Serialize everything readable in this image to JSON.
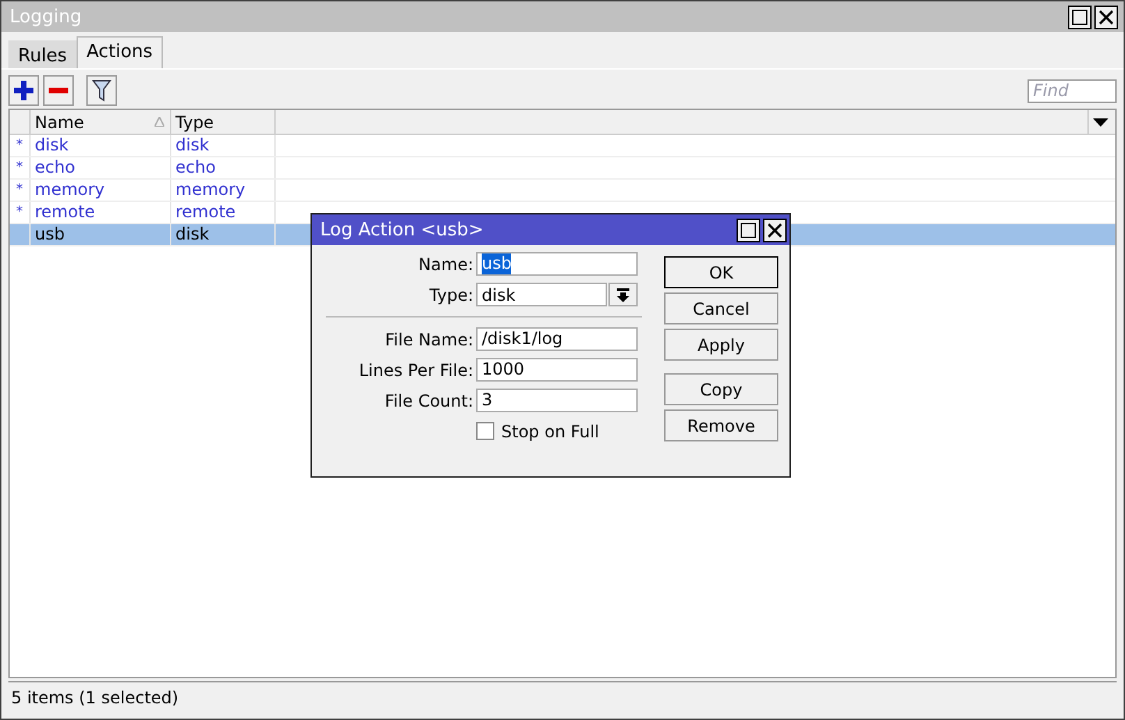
{
  "window": {
    "title": "Logging"
  },
  "tabs": [
    {
      "label": "Rules",
      "selected": false
    },
    {
      "label": "Actions",
      "selected": true
    }
  ],
  "search": {
    "placeholder": "Find"
  },
  "table": {
    "columns": [
      "Name",
      "Type"
    ],
    "rows": [
      {
        "flag": "*",
        "name": "disk",
        "type": "disk",
        "default": true,
        "selected": false
      },
      {
        "flag": "*",
        "name": "echo",
        "type": "echo",
        "default": true,
        "selected": false
      },
      {
        "flag": "*",
        "name": "memory",
        "type": "memory",
        "default": true,
        "selected": false
      },
      {
        "flag": "*",
        "name": "remote",
        "type": "remote",
        "default": true,
        "selected": false
      },
      {
        "name": "usb",
        "type": "disk",
        "default": false,
        "selected": true
      }
    ]
  },
  "status_bar": "5 items (1 selected)",
  "dialog": {
    "title": "Log Action <usb>",
    "fields": [
      {
        "kind": "text",
        "label": "Name:",
        "value": "usb",
        "highlighted": true
      },
      {
        "kind": "select",
        "label": "Type:",
        "value": "disk"
      },
      {
        "kind": "divider"
      },
      {
        "kind": "text",
        "label": "File Name:",
        "value": "/disk1/log",
        "highlighted": false
      },
      {
        "kind": "text",
        "label": "Lines Per File:",
        "value": "1000",
        "highlighted": false
      },
      {
        "kind": "text",
        "label": "File Count:",
        "value": "3",
        "highlighted": false
      },
      {
        "kind": "checkbox",
        "label": "Stop on Full",
        "checked": false
      }
    ],
    "buttons": [
      {
        "label": "OK",
        "default": true
      },
      {
        "label": "Cancel",
        "default": false
      },
      {
        "label": "Apply",
        "default": false
      }
    ],
    "extra_buttons": [
      {
        "label": "Copy",
        "default": false
      },
      {
        "label": "Remove",
        "default": false
      }
    ]
  }
}
